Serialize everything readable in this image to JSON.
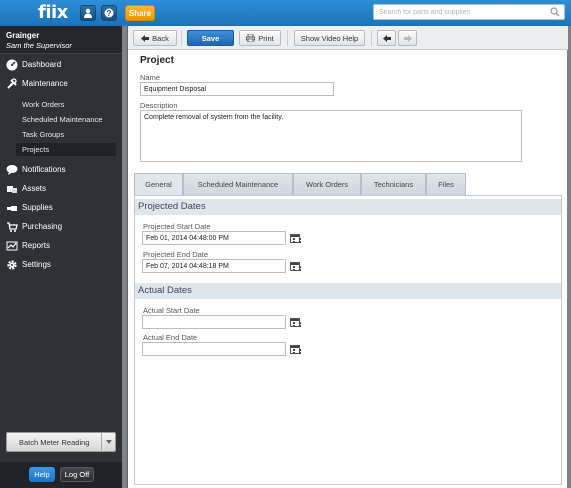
{
  "header": {
    "logo": "fiix",
    "share_label": "Share",
    "user_icon": "user-icon",
    "help_icon": "question-icon",
    "search_placeholder": "Search for parts and supplies"
  },
  "sidebar": {
    "org": "Grainger",
    "user": "Sam the Supervisor",
    "nav": [
      {
        "label": "Dashboard",
        "icon": "dashboard-icon"
      },
      {
        "label": "Maintenance",
        "icon": "tools-icon"
      },
      {
        "label": "Notifications",
        "icon": "speech-bubble-icon"
      },
      {
        "label": "Assets",
        "icon": "boxes-icon"
      },
      {
        "label": "Supplies",
        "icon": "supplies-icon"
      },
      {
        "label": "Purchasing",
        "icon": "cart-icon"
      },
      {
        "label": "Reports",
        "icon": "chart-icon"
      },
      {
        "label": "Settings",
        "icon": "gear-icon"
      }
    ],
    "maintenance_sub": [
      "Work Orders",
      "Scheduled Maintenance",
      "Task Groups",
      "Projects"
    ],
    "active_sub": "Projects",
    "batch_label": "Batch Meter Reading",
    "help_label": "Help",
    "logoff_label": "Log Off"
  },
  "toolbar": {
    "back_label": "Back",
    "save_label": "Save",
    "print_label": "Print",
    "video_help_label": "Show Video Help"
  },
  "form": {
    "title": "Project",
    "name_label": "Name",
    "name_value": "Equipment Disposal",
    "description_label": "Description",
    "description_value": "Complete removal of system from the facility."
  },
  "tabs": [
    "General",
    "Scheduled Maintenance",
    "Work Orders",
    "Technicians",
    "Files"
  ],
  "active_tab": "General",
  "projected": {
    "header": "Projected Dates",
    "start_label": "Projected Start Date",
    "start_value": "Feb 01, 2014 04:48:00 PM",
    "end_label": "Projected End Date",
    "end_value": "Feb 07, 2014 04:48:18 PM"
  },
  "actual": {
    "header": "Actual Dates",
    "start_label": "Actual Start Date",
    "start_value": "",
    "end_label": "Actual End Date",
    "end_value": ""
  }
}
